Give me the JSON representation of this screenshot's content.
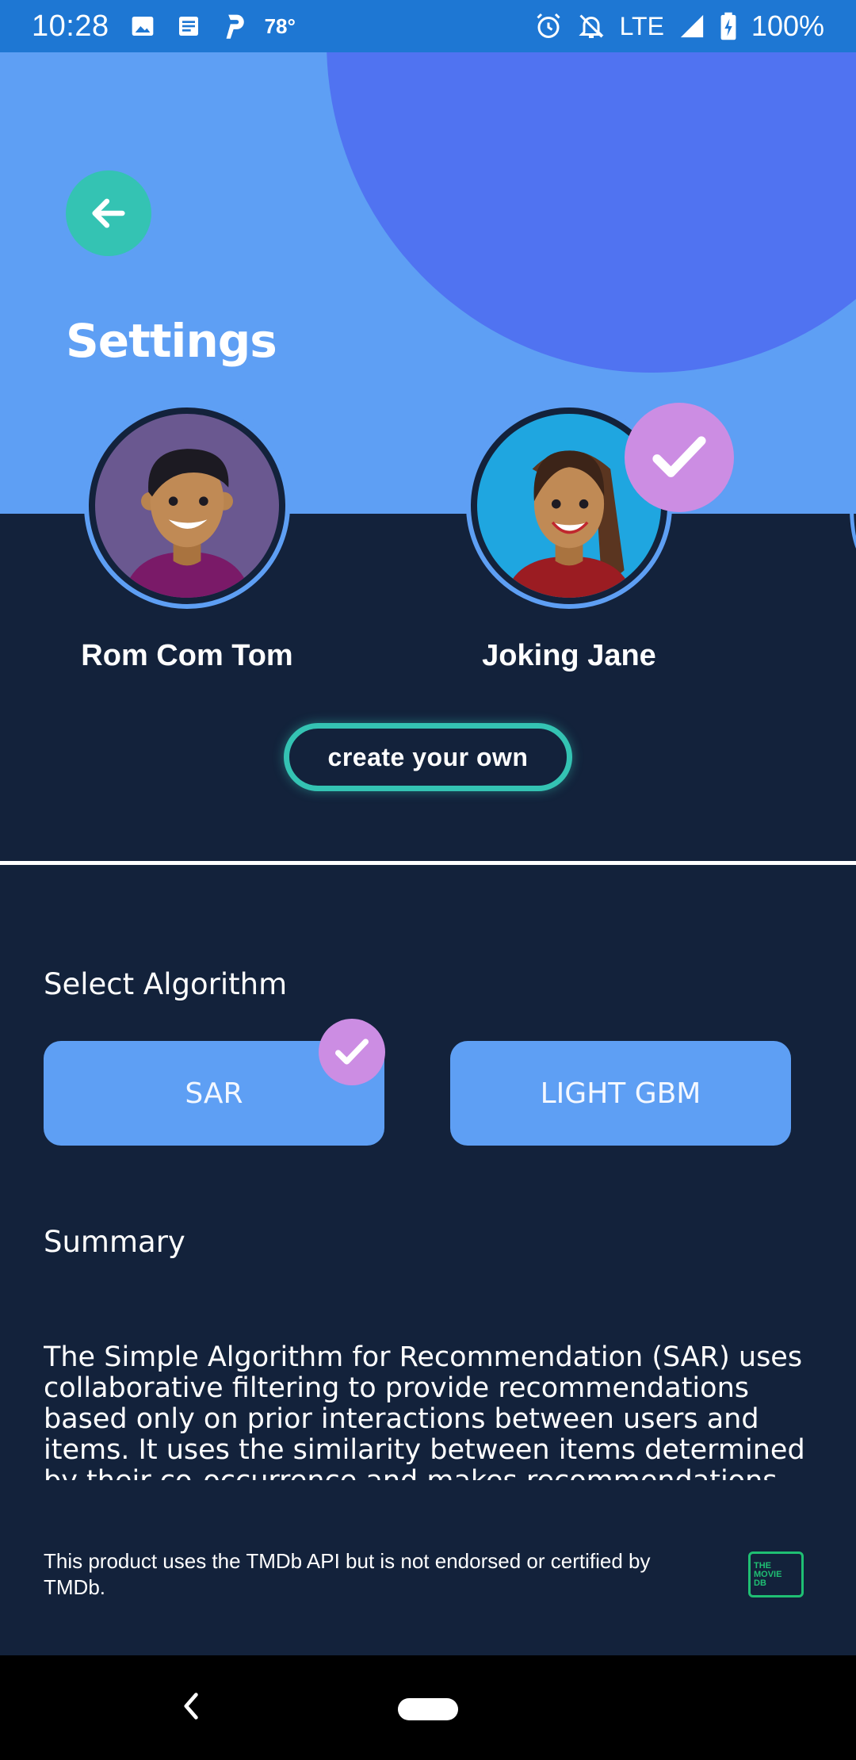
{
  "status_bar": {
    "time": "10:28",
    "temperature": "78°",
    "network": "LTE",
    "battery": "100%",
    "icons": [
      "image-icon",
      "news-icon",
      "parking-icon",
      "alarm-icon",
      "bell-off-icon",
      "signal-icon",
      "battery-charging-icon"
    ]
  },
  "header": {
    "title": "Settings",
    "back_icon": "arrow-left-icon"
  },
  "profiles": [
    {
      "name": "Rom Com Tom",
      "selected": false
    },
    {
      "name": "Joking Jane",
      "selected": true
    }
  ],
  "create_own": {
    "label": "create your own"
  },
  "algorithm": {
    "label": "Select Algorithm",
    "options": [
      {
        "label": "SAR",
        "selected": true
      },
      {
        "label": "LIGHT GBM",
        "selected": false
      }
    ]
  },
  "summary": {
    "label": "Summary",
    "text": "The Simple Algorithm for Recommendation (SAR) uses collaborative filtering to provide recommendations based only on prior interactions between users and items. It uses the similarity between items determined by their co-occurrence and makes recommendations based on a"
  },
  "footer": {
    "disclaimer": "This product uses the TMDb API but is not endorsed or certified by TMDb.",
    "logo": {
      "line1": "THE",
      "line2": "MOVIE",
      "line3": "DB"
    }
  },
  "colors": {
    "status_bar": "#1e77d3",
    "header": "#5e9ff4",
    "header_blob": "#4f6ff0",
    "background": "#13223b",
    "accent_teal": "#34c3b3",
    "check_purple": "#cc8de3",
    "button_blue": "#5e9ff4",
    "tmdb_green": "#1fbf73"
  }
}
